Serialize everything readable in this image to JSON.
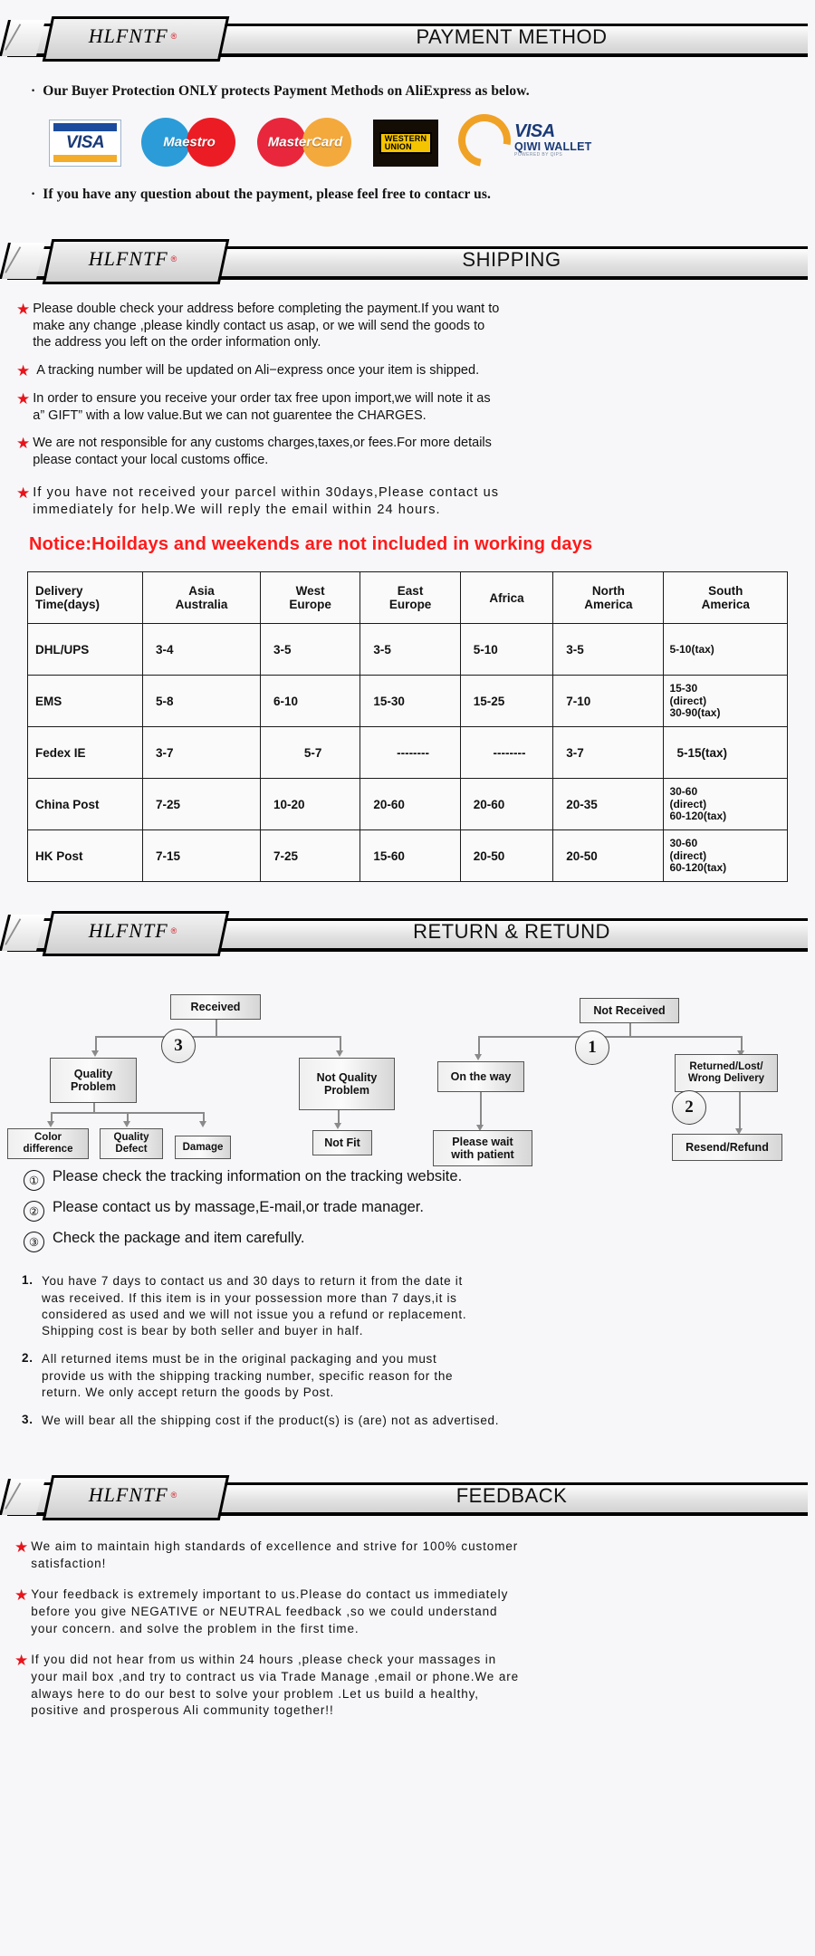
{
  "brand": {
    "name": "HLFNTF",
    "reg": "®"
  },
  "sections": {
    "payment": {
      "title": "PAYMENT METHOD"
    },
    "shipping": {
      "title": "SHIPPING"
    },
    "return": {
      "title": "RETURN & RETUND"
    },
    "feedback": {
      "title": "FEEDBACK"
    }
  },
  "payment": {
    "intro": "Our Buyer Protection ONLY protects Payment Methods on AliExpress as below.",
    "bullet_dot": "·",
    "outro": "If you have any question about the payment, please feel free to contacr us.",
    "logos": [
      {
        "name": "visa-card-logo",
        "label": "VISA"
      },
      {
        "name": "maestro-logo",
        "label": "Maestro"
      },
      {
        "name": "mastercard-logo",
        "label": "MasterCard"
      },
      {
        "name": "western-union-logo",
        "line1": "WESTERN",
        "line2": "UNION"
      },
      {
        "name": "qiwi-wallet-logo",
        "visa": "VISA",
        "wallet": "QIWI WALLET",
        "powered": "POWERED BY QIPS"
      }
    ]
  },
  "shipping": {
    "star": "★",
    "bullets": [
      "Please double check your address before completing the payment.If you want to\nmake any change ,please kindly contact us asap, or we will send the goods to\nthe address you left on the order information only.",
      "A tracking number will be updated on Ali−express once your item is shipped.",
      "In order to ensure you receive your order tax free upon import,we will note it as\na” GIFT” with a low value.But we can not guarentee the CHARGES.",
      "We are not responsible for any customs charges,taxes,or fees.For more details\nplease contact your local customs office."
    ],
    "bullet_spaced": "If you have not received your parcel within 30days,Please contact us\nimmediately for help.We will reply the email within 24 hours.",
    "notice": "Notice:Hoildays and weekends are not included in working days"
  },
  "delivery_table": {
    "headers": [
      "Delivery\nTime(days)",
      "Asia\nAustralia",
      "West\nEurope",
      "East\nEurope",
      "Africa",
      "North\nAmerica",
      "South\nAmerica"
    ],
    "rows": [
      {
        "method": "DHL/UPS",
        "cells": [
          "3-4",
          "3-5",
          "3-5",
          "5-10",
          "3-5",
          "5-10(tax)"
        ]
      },
      {
        "method": "EMS",
        "cells": [
          "5-8",
          "6-10",
          "15-30",
          "15-25",
          "7-10",
          "15-30\n(direct)\n30-90(tax)"
        ]
      },
      {
        "method": "Fedex IE",
        "cells": [
          "3-7",
          "5-7",
          "--------",
          "--------",
          "3-7",
          "5-15(tax)"
        ]
      },
      {
        "method": "China Post",
        "cells": [
          "7-25",
          "10-20",
          "20-60",
          "20-60",
          "20-35",
          "30-60\n(direct)\n60-120(tax)"
        ]
      },
      {
        "method": "HK Post",
        "cells": [
          "7-15",
          "7-25",
          "15-60",
          "20-50",
          "20-50",
          "30-60\n(direct)\n60-120(tax)"
        ]
      }
    ]
  },
  "flowchart": {
    "left": {
      "root": "Received",
      "circle": "3",
      "branch_a": "Quality\nProblem",
      "branch_b": "Not Quality\nProblem",
      "leaves_a": [
        "Color\ndifference",
        "Quality\nDefect",
        "Damage"
      ],
      "leaf_b": "Not Fit"
    },
    "right": {
      "root": "Not  Received",
      "circle_top": "1",
      "circle_bottom": "2",
      "branch_a": "On the way",
      "branch_b": "Returned/Lost/\nWrong Delivery",
      "leaf_a": "Please wait\nwith patient",
      "leaf_b": "Resend/Refund"
    }
  },
  "return_notes": [
    {
      "num": "①",
      "text": "Please check the tracking information on the tracking website."
    },
    {
      "num": "②",
      "text": "Please contact us by  massage,E-mail,or trade manager."
    },
    {
      "num": "③",
      "text": "Check the package and item carefully."
    }
  ],
  "return_policy": [
    {
      "idx": "1.",
      "text": "You have 7 days to contact us and 30 days to return it from the date it\nwas received. If this item is in your possession more than 7 days,it is\nconsidered as used and we will not issue you a refund or replacement.\nShipping cost is bear by both seller and buyer in half."
    },
    {
      "idx": "2.",
      "text": "All returned items must be in the original packaging and you must\nprovide us with the shipping tracking number, specific reason for the\nreturn. We only accept return the goods by Post."
    },
    {
      "idx": "3.",
      "text": "We will bear all the shipping cost if the product(s) is (are) not as advertised."
    }
  ],
  "feedback": [
    "We aim to maintain high standards of excellence and strive  for 100% customer\nsatisfaction!",
    "Your feedback is extremely important to us.Please do contact us immediately\nbefore you give NEGATIVE or NEUTRAL feedback ,so  we could understand\nyour concern. and solve the problem in the first time.",
    "If you did not hear from us within 24 hours ,please check your massages in\nyour mail box ,and try to contract us via Trade Manage ,email or phone.We are\nalways here to do our best to solve your problem .Let us build a healthy,\npositive and prosperous Ali community together!!"
  ],
  "colors": {
    "accent_red": "#e8141b",
    "notice_red": "#ff1a1a",
    "brand_reg": "#d4121a"
  }
}
